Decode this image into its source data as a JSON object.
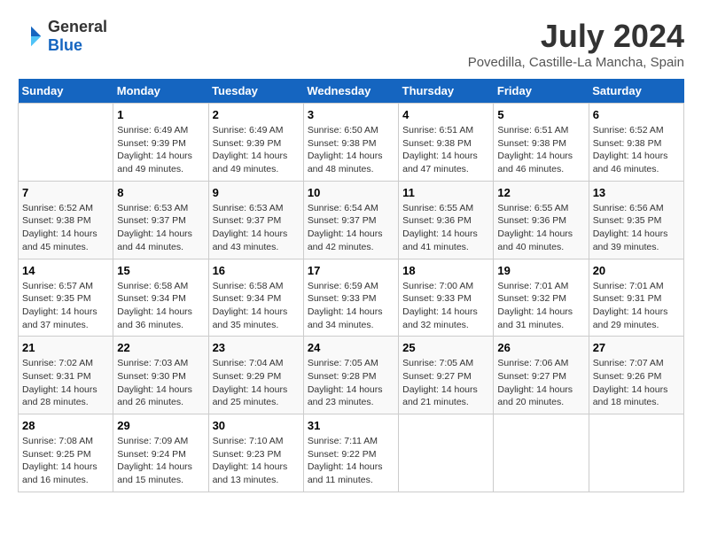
{
  "header": {
    "logo": {
      "text_general": "General",
      "text_blue": "Blue"
    },
    "title": "July 2024",
    "subtitle": "Povedilla, Castille-La Mancha, Spain"
  },
  "calendar": {
    "days_of_week": [
      "Sunday",
      "Monday",
      "Tuesday",
      "Wednesday",
      "Thursday",
      "Friday",
      "Saturday"
    ],
    "weeks": [
      {
        "days": [
          {
            "date": "",
            "content": ""
          },
          {
            "date": "1",
            "content": "Sunrise: 6:49 AM\nSunset: 9:39 PM\nDaylight: 14 hours\nand 49 minutes."
          },
          {
            "date": "2",
            "content": "Sunrise: 6:49 AM\nSunset: 9:39 PM\nDaylight: 14 hours\nand 49 minutes."
          },
          {
            "date": "3",
            "content": "Sunrise: 6:50 AM\nSunset: 9:38 PM\nDaylight: 14 hours\nand 48 minutes."
          },
          {
            "date": "4",
            "content": "Sunrise: 6:51 AM\nSunset: 9:38 PM\nDaylight: 14 hours\nand 47 minutes."
          },
          {
            "date": "5",
            "content": "Sunrise: 6:51 AM\nSunset: 9:38 PM\nDaylight: 14 hours\nand 46 minutes."
          },
          {
            "date": "6",
            "content": "Sunrise: 6:52 AM\nSunset: 9:38 PM\nDaylight: 14 hours\nand 46 minutes."
          }
        ]
      },
      {
        "days": [
          {
            "date": "7",
            "content": "Sunrise: 6:52 AM\nSunset: 9:38 PM\nDaylight: 14 hours\nand 45 minutes."
          },
          {
            "date": "8",
            "content": "Sunrise: 6:53 AM\nSunset: 9:37 PM\nDaylight: 14 hours\nand 44 minutes."
          },
          {
            "date": "9",
            "content": "Sunrise: 6:53 AM\nSunset: 9:37 PM\nDaylight: 14 hours\nand 43 minutes."
          },
          {
            "date": "10",
            "content": "Sunrise: 6:54 AM\nSunset: 9:37 PM\nDaylight: 14 hours\nand 42 minutes."
          },
          {
            "date": "11",
            "content": "Sunrise: 6:55 AM\nSunset: 9:36 PM\nDaylight: 14 hours\nand 41 minutes."
          },
          {
            "date": "12",
            "content": "Sunrise: 6:55 AM\nSunset: 9:36 PM\nDaylight: 14 hours\nand 40 minutes."
          },
          {
            "date": "13",
            "content": "Sunrise: 6:56 AM\nSunset: 9:35 PM\nDaylight: 14 hours\nand 39 minutes."
          }
        ]
      },
      {
        "days": [
          {
            "date": "14",
            "content": "Sunrise: 6:57 AM\nSunset: 9:35 PM\nDaylight: 14 hours\nand 37 minutes."
          },
          {
            "date": "15",
            "content": "Sunrise: 6:58 AM\nSunset: 9:34 PM\nDaylight: 14 hours\nand 36 minutes."
          },
          {
            "date": "16",
            "content": "Sunrise: 6:58 AM\nSunset: 9:34 PM\nDaylight: 14 hours\nand 35 minutes."
          },
          {
            "date": "17",
            "content": "Sunrise: 6:59 AM\nSunset: 9:33 PM\nDaylight: 14 hours\nand 34 minutes."
          },
          {
            "date": "18",
            "content": "Sunrise: 7:00 AM\nSunset: 9:33 PM\nDaylight: 14 hours\nand 32 minutes."
          },
          {
            "date": "19",
            "content": "Sunrise: 7:01 AM\nSunset: 9:32 PM\nDaylight: 14 hours\nand 31 minutes."
          },
          {
            "date": "20",
            "content": "Sunrise: 7:01 AM\nSunset: 9:31 PM\nDaylight: 14 hours\nand 29 minutes."
          }
        ]
      },
      {
        "days": [
          {
            "date": "21",
            "content": "Sunrise: 7:02 AM\nSunset: 9:31 PM\nDaylight: 14 hours\nand 28 minutes."
          },
          {
            "date": "22",
            "content": "Sunrise: 7:03 AM\nSunset: 9:30 PM\nDaylight: 14 hours\nand 26 minutes."
          },
          {
            "date": "23",
            "content": "Sunrise: 7:04 AM\nSunset: 9:29 PM\nDaylight: 14 hours\nand 25 minutes."
          },
          {
            "date": "24",
            "content": "Sunrise: 7:05 AM\nSunset: 9:28 PM\nDaylight: 14 hours\nand 23 minutes."
          },
          {
            "date": "25",
            "content": "Sunrise: 7:05 AM\nSunset: 9:27 PM\nDaylight: 14 hours\nand 21 minutes."
          },
          {
            "date": "26",
            "content": "Sunrise: 7:06 AM\nSunset: 9:27 PM\nDaylight: 14 hours\nand 20 minutes."
          },
          {
            "date": "27",
            "content": "Sunrise: 7:07 AM\nSunset: 9:26 PM\nDaylight: 14 hours\nand 18 minutes."
          }
        ]
      },
      {
        "days": [
          {
            "date": "28",
            "content": "Sunrise: 7:08 AM\nSunset: 9:25 PM\nDaylight: 14 hours\nand 16 minutes."
          },
          {
            "date": "29",
            "content": "Sunrise: 7:09 AM\nSunset: 9:24 PM\nDaylight: 14 hours\nand 15 minutes."
          },
          {
            "date": "30",
            "content": "Sunrise: 7:10 AM\nSunset: 9:23 PM\nDaylight: 14 hours\nand 13 minutes."
          },
          {
            "date": "31",
            "content": "Sunrise: 7:11 AM\nSunset: 9:22 PM\nDaylight: 14 hours\nand 11 minutes."
          },
          {
            "date": "",
            "content": ""
          },
          {
            "date": "",
            "content": ""
          },
          {
            "date": "",
            "content": ""
          }
        ]
      }
    ]
  }
}
